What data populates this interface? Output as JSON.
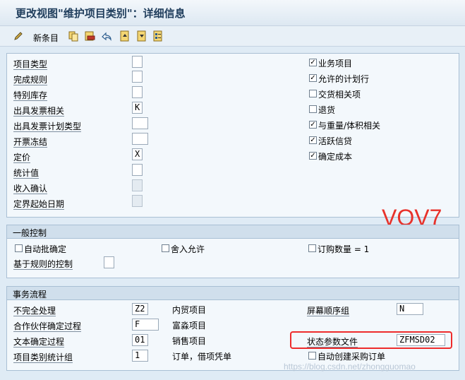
{
  "window": {
    "title": "更改视图\"维护项目类别\"：详细信息"
  },
  "toolbar": {
    "new_entry_label": "新条目",
    "icons": [
      "edit-icon",
      "copy-icon",
      "delete-icon",
      "undo-icon",
      "prev-entry-icon",
      "next-entry-icon",
      "select-icon"
    ]
  },
  "detail": {
    "rows": [
      {
        "label": "项目类型",
        "value": ""
      },
      {
        "label": "完成规则",
        "value": ""
      },
      {
        "label": "特别库存",
        "value": ""
      },
      {
        "label": "出具发票相关",
        "value": "K"
      },
      {
        "label": "出具发票计划类型",
        "value": ""
      },
      {
        "label": "开票冻结",
        "value": ""
      },
      {
        "label": "定价",
        "value": "X"
      },
      {
        "label": "统计值",
        "value": ""
      },
      {
        "label": "收入确认",
        "value": ""
      },
      {
        "label": "定界起始日期",
        "value": ""
      }
    ],
    "checks": [
      {
        "label": "业务项目",
        "checked": true
      },
      {
        "label": "允许的计划行",
        "checked": true
      },
      {
        "label": "交货相关项",
        "checked": false
      },
      {
        "label": "退货",
        "checked": false
      },
      {
        "label": "与重量/体积相关",
        "checked": true
      },
      {
        "label": "活跃信贷",
        "checked": true
      },
      {
        "label": "确定成本",
        "checked": true
      }
    ]
  },
  "general": {
    "title": "一般控制",
    "auto_batch": "自动批确定",
    "round_allowed": "舍入允许",
    "order_qty": "订购数量 = 1",
    "rule_based": "基于规则的控制"
  },
  "transaction": {
    "title": "事务流程",
    "rows": [
      {
        "label": "不完全处理",
        "value": "Z2",
        "desc": "内贸项目"
      },
      {
        "label": "合作伙伴确定过程",
        "value": "F",
        "desc": "富淼项目"
      },
      {
        "label": "文本确定过程",
        "value": "01",
        "desc": "销售项目"
      },
      {
        "label": "项目类别统计组",
        "value": "1",
        "desc": "订单，借项凭单"
      }
    ],
    "screen_seq_label": "屏幕顺序组",
    "screen_seq_value": "N",
    "status_profile_label": "状态参数文件",
    "status_profile_value": "ZFMSD02",
    "auto_po_label": "自动创建采购订单"
  },
  "annotation": {
    "text": "VOV7",
    "color": "#e8322b"
  },
  "watermark": "https://blog.csdn.net/zhongguomao"
}
